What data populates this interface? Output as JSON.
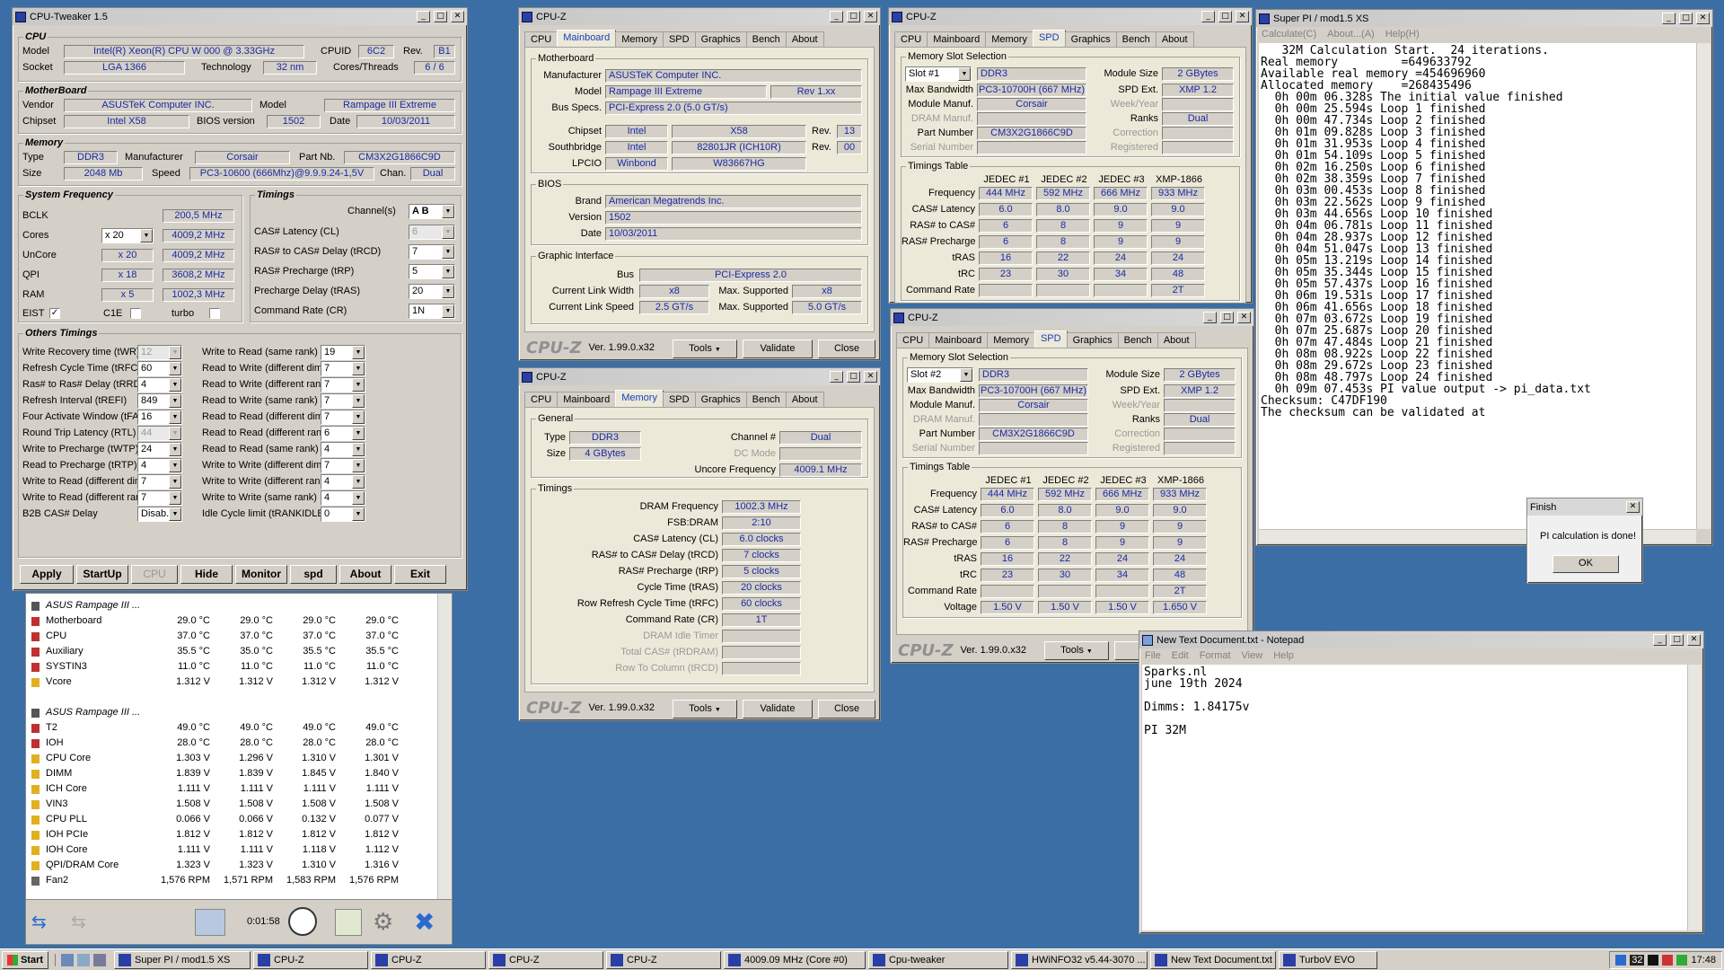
{
  "tweaker": {
    "title": "CPU-Tweaker 1.5",
    "cpu": {
      "label": "CPU",
      "model_l": "Model",
      "model": "Intel(R) Xeon(R) CPU       W 000  @ 3.33GHz",
      "cpuid_l": "CPUID",
      "cpuid": "6C2",
      "rev_l": "Rev.",
      "rev": "B1",
      "socket_l": "Socket",
      "socket": "LGA 1366",
      "tech_l": "Technology",
      "tech": "32 nm",
      "cores_l": "Cores/Threads",
      "cores": "6 / 6"
    },
    "mb": {
      "label": "MotherBoard",
      "vendor_l": "Vendor",
      "vendor": "ASUSTeK Computer INC.",
      "model_l": "Model",
      "model": "Rampage III Extreme",
      "chipset_l": "Chipset",
      "chipset": "Intel X58",
      "bios_l": "BIOS version",
      "bios": "1502",
      "date_l": "Date",
      "date": "10/03/2011"
    },
    "mem": {
      "label": "Memory",
      "type_l": "Type",
      "type": "DDR3",
      "manuf_l": "Manufacturer",
      "manuf": "Corsair",
      "part_l": "Part Nb.",
      "part": "CM3X2G1866C9D",
      "size_l": "Size",
      "size": "2048 Mb",
      "speed_l": "Speed",
      "speed": "PC3-10600 (666Mhz)@9.9.9.24-1,5V",
      "chan_l": "Chan.",
      "chan": "Dual"
    },
    "sysfreq": {
      "label": "System Frequency",
      "bclk_l": "BCLK",
      "bclk": "200,5 MHz",
      "cores_l": "Cores",
      "cores_mult": "x 20",
      "cores": "4009,2 MHz",
      "uncore_l": "UnCore",
      "uncore_mult": "x 20",
      "uncore": "4009,2 MHz",
      "qpi_l": "QPI",
      "qpi_mult": "x 18",
      "qpi": "3608,2 MHz",
      "ram_l": "RAM",
      "ram_mult": "x 5",
      "ram": "1002,3 MHz",
      "eist": "EIST",
      "c1e": "C1E",
      "turbo": "turbo"
    },
    "timings": {
      "label": "Timings",
      "channels_l": "Channel(s)",
      "channels": "A  B",
      "cl_l": "CAS# Latency (CL)",
      "cl": "6",
      "trcd_l": "RAS# to CAS# Delay (tRCD)",
      "trcd": "7",
      "trp_l": "RAS# Precharge (tRP)",
      "trp": "5",
      "tras_l": "Precharge Delay (tRAS)",
      "tras": "20",
      "cr_l": "Command Rate (CR)",
      "cr": "1N"
    },
    "others": {
      "label": "Others Timings",
      "left": [
        {
          "l": "Write Recovery time (tWR)",
          "v": "12",
          "dis": true
        },
        {
          "l": "Refresh Cycle Time (tRFC)",
          "v": "60"
        },
        {
          "l": "Ras# to Ras# Delay (tRRD)",
          "v": "4"
        },
        {
          "l": "Refresh Interval (tREFI)",
          "v": "849"
        },
        {
          "l": "Four Activate Window (tFAW)",
          "v": "16"
        },
        {
          "l": "Round Trip Latency (RTL)",
          "v": "44",
          "dis": true
        },
        {
          "l": "Write to Precharge (tWTP)",
          "v": "24"
        },
        {
          "l": "Read to Precharge (tRTP)",
          "v": "4"
        },
        {
          "l": "Write to Read (different dimms)",
          "v": "7"
        },
        {
          "l": "Write to Read (different ranks)",
          "v": "7"
        },
        {
          "l": "B2B CAS# Delay",
          "v": "Disab."
        }
      ],
      "right": [
        {
          "l": "Write to Read (same rank)",
          "v": "19"
        },
        {
          "l": "Read to Write (different dimms)",
          "v": "7"
        },
        {
          "l": "Read to Write (different ranks)",
          "v": "7"
        },
        {
          "l": "Read to Write (same rank)",
          "v": "7"
        },
        {
          "l": "Read to Read (different dimms)",
          "v": "7"
        },
        {
          "l": "Read to Read (different ranks)",
          "v": "6"
        },
        {
          "l": "Read to Read (same rank)",
          "v": "4"
        },
        {
          "l": "Write to Write (different dimms)",
          "v": "7"
        },
        {
          "l": "Write to Write (different ranks)",
          "v": "4"
        },
        {
          "l": "Write to Write (same rank)",
          "v": "4"
        },
        {
          "l": "Idle Cycle limit (tRANKIDLE)",
          "v": "0"
        }
      ]
    },
    "buttons": [
      "Apply",
      "StartUp",
      "CPU",
      "Hide",
      "Monitor",
      "spd",
      "About",
      "Exit"
    ]
  },
  "hwinfo": {
    "groups": [
      {
        "name": "ASUS Rampage III ...",
        "rows": [
          {
            "n": "Motherboard",
            "v": [
              "29.0 °C",
              "29.0 °C",
              "29.0 °C",
              "29.0 °C"
            ],
            "ic": "temp"
          },
          {
            "n": "CPU",
            "v": [
              "37.0 °C",
              "37.0 °C",
              "37.0 °C",
              "37.0 °C"
            ],
            "ic": "temp"
          },
          {
            "n": "Auxiliary",
            "v": [
              "35.5 °C",
              "35.0 °C",
              "35.5 °C",
              "35.5 °C"
            ],
            "ic": "temp"
          },
          {
            "n": "SYSTIN3",
            "v": [
              "11.0 °C",
              "11.0 °C",
              "11.0 °C",
              "11.0 °C"
            ],
            "ic": "temp"
          },
          {
            "n": "Vcore",
            "v": [
              "1.312 V",
              "1.312 V",
              "1.312 V",
              "1.312 V"
            ],
            "ic": "volt"
          }
        ]
      },
      {
        "name": "ASUS Rampage III ...",
        "rows": [
          {
            "n": "T2",
            "v": [
              "49.0 °C",
              "49.0 °C",
              "49.0 °C",
              "49.0 °C"
            ],
            "ic": "temp"
          },
          {
            "n": "IOH",
            "v": [
              "28.0 °C",
              "28.0 °C",
              "28.0 °C",
              "28.0 °C"
            ],
            "ic": "temp"
          },
          {
            "n": "CPU Core",
            "v": [
              "1.303 V",
              "1.296 V",
              "1.310 V",
              "1.301 V"
            ],
            "ic": "volt"
          },
          {
            "n": "DIMM",
            "v": [
              "1.839 V",
              "1.839 V",
              "1.845 V",
              "1.840 V"
            ],
            "ic": "volt"
          },
          {
            "n": "ICH Core",
            "v": [
              "1.111 V",
              "1.111 V",
              "1.111 V",
              "1.111 V"
            ],
            "ic": "volt"
          },
          {
            "n": "VIN3",
            "v": [
              "1.508 V",
              "1.508 V",
              "1.508 V",
              "1.508 V"
            ],
            "ic": "volt"
          },
          {
            "n": "CPU PLL",
            "v": [
              "0.066 V",
              "0.066 V",
              "0.132 V",
              "0.077 V"
            ],
            "ic": "volt"
          },
          {
            "n": "IOH PCIe",
            "v": [
              "1.812 V",
              "1.812 V",
              "1.812 V",
              "1.812 V"
            ],
            "ic": "volt"
          },
          {
            "n": "IOH Core",
            "v": [
              "1.111 V",
              "1.111 V",
              "1.118 V",
              "1.112 V"
            ],
            "ic": "volt"
          },
          {
            "n": "QPI/DRAM Core",
            "v": [
              "1.323 V",
              "1.323 V",
              "1.310 V",
              "1.316 V"
            ],
            "ic": "volt"
          },
          {
            "n": "Fan2",
            "v": [
              "1,576 RPM",
              "1,571 RPM",
              "1,583 RPM",
              "1,576 RPM"
            ],
            "ic": "fan"
          }
        ]
      }
    ],
    "timer": "0:01:58"
  },
  "cpuz_mb": {
    "title": "CPU-Z",
    "tabs": [
      "CPU",
      "Mainboard",
      "Memory",
      "SPD",
      "Graphics",
      "Bench",
      "About"
    ],
    "active": 1,
    "mb_label": "Motherboard",
    "manuf_l": "Manufacturer",
    "manuf": "ASUSTeK Computer INC.",
    "model_l": "Model",
    "model": "Rampage III Extreme",
    "model_rev": "Rev 1.xx",
    "bus_l": "Bus Specs.",
    "bus": "PCI-Express 2.0 (5.0 GT/s)",
    "chipset_l": "Chipset",
    "chipset_v": "Intel",
    "chipset_m": "X58",
    "chipset_rev_l": "Rev.",
    "chipset_rev": "13",
    "south_l": "Southbridge",
    "south_v": "Intel",
    "south_m": "82801JR (ICH10R)",
    "south_rev_l": "Rev.",
    "south_rev": "00",
    "lpcio_l": "LPCIO",
    "lpcio_v": "Winbond",
    "lpcio_m": "W83667HG",
    "bios_label": "BIOS",
    "brand_l": "Brand",
    "brand": "American Megatrends Inc.",
    "ver_l": "Version",
    "ver": "1502",
    "date_l": "Date",
    "date": "10/03/2011",
    "gi_label": "Graphic Interface",
    "gbus_l": "Bus",
    "gbus": "PCI-Express 2.0",
    "clw_l": "Current Link Width",
    "clw": "x8",
    "msw_l": "Max. Supported",
    "msw": "x8",
    "cls_l": "Current Link Speed",
    "cls": "2.5 GT/s",
    "mss_l": "Max. Supported",
    "mss": "5.0 GT/s",
    "ver_text": "Ver. 1.99.0.x32",
    "tools": "Tools",
    "validate": "Validate",
    "close": "Close"
  },
  "cpuz_mem": {
    "title": "CPU-Z",
    "tabs": [
      "CPU",
      "Mainboard",
      "Memory",
      "SPD",
      "Graphics",
      "Bench",
      "About"
    ],
    "active": 2,
    "gen_label": "General",
    "type_l": "Type",
    "type": "DDR3",
    "chan_l": "Channel #",
    "chan": "Dual",
    "size_l": "Size",
    "size": "4 GBytes",
    "dc_l": "DC Mode",
    "unc_l": "Uncore Frequency",
    "unc": "4009.1 MHz",
    "tim_label": "Timings",
    "rows": [
      {
        "l": "DRAM Frequency",
        "v": "1002.3 MHz"
      },
      {
        "l": "FSB:DRAM",
        "v": "2:10"
      },
      {
        "l": "CAS# Latency (CL)",
        "v": "6.0 clocks"
      },
      {
        "l": "RAS# to CAS# Delay (tRCD)",
        "v": "7 clocks"
      },
      {
        "l": "RAS# Precharge (tRP)",
        "v": "5 clocks"
      },
      {
        "l": "Cycle Time (tRAS)",
        "v": "20 clocks"
      },
      {
        "l": "Row Refresh Cycle Time (tRFC)",
        "v": "60 clocks"
      },
      {
        "l": "Command Rate (CR)",
        "v": "1T"
      },
      {
        "l": "DRAM Idle Timer",
        "v": "",
        "dis": true
      },
      {
        "l": "Total CAS# (tRDRAM)",
        "v": "",
        "dis": true
      },
      {
        "l": "Row To Column (tRCD)",
        "v": "",
        "dis": true
      }
    ],
    "ver_text": "Ver. 1.99.0.x32",
    "tools": "Tools",
    "validate": "Validate",
    "close": "Close"
  },
  "cpuz_spd1": {
    "title": "CPU-Z",
    "tabs": [
      "CPU",
      "Mainboard",
      "Memory",
      "SPD",
      "Graphics",
      "Bench",
      "About"
    ],
    "active": 3,
    "slot_label": "Memory Slot Selection",
    "slot": "Slot #1",
    "type": "DDR3",
    "modsize_l": "Module Size",
    "modsize": "2 GBytes",
    "maxbw_l": "Max Bandwidth",
    "maxbw": "PC3-10700H (667 MHz)",
    "spdext_l": "SPD Ext.",
    "spdext": "XMP 1.2",
    "manuf_l": "Module Manuf.",
    "manuf": "Corsair",
    "week_l": "Week/Year",
    "dram_l": "DRAM Manuf.",
    "ranks_l": "Ranks",
    "ranks": "Dual",
    "part_l": "Part Number",
    "part": "CM3X2G1866C9D",
    "corr_l": "Correction",
    "serial_l": "Serial Number",
    "reg_l": "Registered",
    "tt_label": "Timings Table",
    "cols": [
      "JEDEC #1",
      "JEDEC #2",
      "JEDEC #3",
      "XMP-1866"
    ],
    "rows": [
      {
        "l": "Frequency",
        "v": [
          "444 MHz",
          "592 MHz",
          "666 MHz",
          "933 MHz"
        ]
      },
      {
        "l": "CAS# Latency",
        "v": [
          "6.0",
          "8.0",
          "9.0",
          "9.0"
        ]
      },
      {
        "l": "RAS# to CAS#",
        "v": [
          "6",
          "8",
          "9",
          "9"
        ]
      },
      {
        "l": "RAS# Precharge",
        "v": [
          "6",
          "8",
          "9",
          "9"
        ]
      },
      {
        "l": "tRAS",
        "v": [
          "16",
          "22",
          "24",
          "24"
        ]
      },
      {
        "l": "tRC",
        "v": [
          "23",
          "30",
          "34",
          "48"
        ]
      },
      {
        "l": "Command Rate",
        "v": [
          "",
          "",
          "",
          "2T"
        ]
      }
    ]
  },
  "cpuz_spd2": {
    "title": "CPU-Z",
    "tabs": [
      "CPU",
      "Mainboard",
      "Memory",
      "SPD",
      "Graphics",
      "Bench",
      "About"
    ],
    "active": 3,
    "slot_label": "Memory Slot Selection",
    "slot": "Slot #2",
    "type": "DDR3",
    "modsize_l": "Module Size",
    "modsize": "2 GBytes",
    "maxbw_l": "Max Bandwidth",
    "maxbw": "PC3-10700H (667 MHz)",
    "spdext_l": "SPD Ext.",
    "spdext": "XMP 1.2",
    "manuf_l": "Module Manuf.",
    "manuf": "Corsair",
    "week_l": "Week/Year",
    "dram_l": "DRAM Manuf.",
    "ranks_l": "Ranks",
    "ranks": "Dual",
    "part_l": "Part Number",
    "part": "CM3X2G1866C9D",
    "corr_l": "Correction",
    "serial_l": "Serial Number",
    "reg_l": "Registered",
    "tt_label": "Timings Table",
    "cols": [
      "JEDEC #1",
      "JEDEC #2",
      "JEDEC #3",
      "XMP-1866"
    ],
    "rows": [
      {
        "l": "Frequency",
        "v": [
          "444 MHz",
          "592 MHz",
          "666 MHz",
          "933 MHz"
        ]
      },
      {
        "l": "CAS# Latency",
        "v": [
          "6.0",
          "8.0",
          "9.0",
          "9.0"
        ]
      },
      {
        "l": "RAS# to CAS#",
        "v": [
          "6",
          "8",
          "9",
          "9"
        ]
      },
      {
        "l": "RAS# Precharge",
        "v": [
          "6",
          "8",
          "9",
          "9"
        ]
      },
      {
        "l": "tRAS",
        "v": [
          "16",
          "22",
          "24",
          "24"
        ]
      },
      {
        "l": "tRC",
        "v": [
          "23",
          "30",
          "34",
          "48"
        ]
      },
      {
        "l": "Command Rate",
        "v": [
          "",
          "",
          "",
          "2T"
        ]
      },
      {
        "l": "Voltage",
        "v": [
          "1.50 V",
          "1.50 V",
          "1.50 V",
          "1.650 V"
        ]
      }
    ],
    "ver_text": "Ver. 1.99.0.x32",
    "tools": "Tools",
    "validate": "Va"
  },
  "superpi": {
    "title": "Super PI / mod1.5 XS",
    "menu": [
      "Calculate(C)",
      "About...(A)",
      "Help(H)"
    ],
    "lines": [
      "   32M Calculation Start.  24 iterations.",
      "Real memory         =649633792",
      "Available real memory =454696960",
      "Allocated memory    =268435496",
      "  0h 00m 06.328s The initial value finished",
      "  0h 00m 25.594s Loop 1 finished",
      "  0h 00m 47.734s Loop 2 finished",
      "  0h 01m 09.828s Loop 3 finished",
      "  0h 01m 31.953s Loop 4 finished",
      "  0h 01m 54.109s Loop 5 finished",
      "  0h 02m 16.250s Loop 6 finished",
      "  0h 02m 38.359s Loop 7 finished",
      "  0h 03m 00.453s Loop 8 finished",
      "  0h 03m 22.562s Loop 9 finished",
      "  0h 03m 44.656s Loop 10 finished",
      "  0h 04m 06.781s Loop 11 finished",
      "  0h 04m 28.937s Loop 12 finished",
      "  0h 04m 51.047s Loop 13 finished",
      "  0h 05m 13.219s Loop 14 finished",
      "  0h 05m 35.344s Loop 15 finished",
      "  0h 05m 57.437s Loop 16 finished",
      "  0h 06m 19.531s Loop 17 finished",
      "  0h 06m 41.656s Loop 18 finished",
      "  0h 07m 03.672s Loop 19 finished",
      "  0h 07m 25.687s Loop 20 finished",
      "  0h 07m 47.484s Loop 21 finished",
      "  0h 08m 08.922s Loop 22 finished",
      "  0h 08m 29.672s Loop 23 finished",
      "  0h 08m 48.797s Loop 24 finished",
      "  0h 09m 07.453s PI value output -> pi_data.txt",
      "",
      "Checksum: C47DF190",
      "The checksum can be validated at"
    ]
  },
  "finish": {
    "title": "Finish",
    "msg": "PI calculation is done!",
    "ok": "OK"
  },
  "notepad": {
    "title": "New Text Document.txt - Notepad",
    "menu": [
      "File",
      "Edit",
      "Format",
      "View",
      "Help"
    ],
    "lines": [
      "Sparks.nl",
      "june 19th 2024",
      "",
      "Dimms: 1.84175v",
      "",
      "PI 32M"
    ]
  },
  "taskbar": {
    "start": "Start",
    "tasks": [
      "Super PI / mod1.5 XS",
      "CPU-Z",
      "CPU-Z",
      "CPU-Z",
      "CPU-Z",
      "4009.09 MHz (Core #0)",
      "Cpu-tweaker",
      "HWiNFO32 v5.44-3070 ...",
      "New Text Document.txt ...",
      "TurboV EVO"
    ],
    "tray_num": "32",
    "clock": "17:48"
  }
}
